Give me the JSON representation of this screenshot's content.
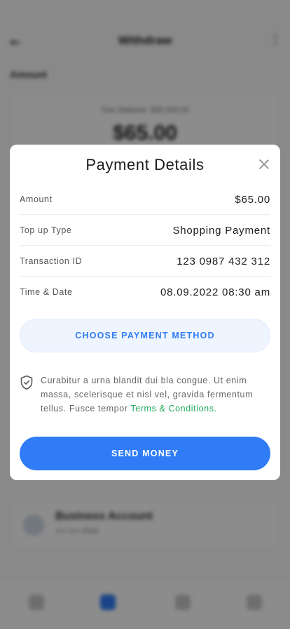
{
  "background": {
    "header_title": "Withdraw",
    "section_title": "Amount",
    "card_label": "Your Balance: $35,000.00",
    "card_amount": "$65.00",
    "account_title": "Business Account",
    "account_sub": "•••• •••• 4568"
  },
  "modal": {
    "title": "Payment Details",
    "rows": [
      {
        "label": "Amount",
        "value": "$65.00"
      },
      {
        "label": "Top up Type",
        "value": "Shopping Payment"
      },
      {
        "label": "Transaction ID",
        "value": "123 0987 432 312"
      },
      {
        "label": "Time & Date",
        "value": "08.09.2022 08:30 am"
      }
    ],
    "choose_label": "CHOOSE PAYMENT METHOD",
    "notice_text": "Curabitur a urna blandit dui bla congue. Ut enim massa, scelerisque et nisl vel, gravida fermentum tellus. Fusce tempor ",
    "notice_link": "Terms & Conditions.",
    "send_label": "SEND MONEY"
  },
  "colors": {
    "accent": "#2f7cf6",
    "link": "#1fa85a",
    "overlay": "rgba(0,0,0,0.45)"
  },
  "icons": [
    "back-arrow-icon",
    "more-icon",
    "close-icon",
    "shield-check-icon"
  ]
}
